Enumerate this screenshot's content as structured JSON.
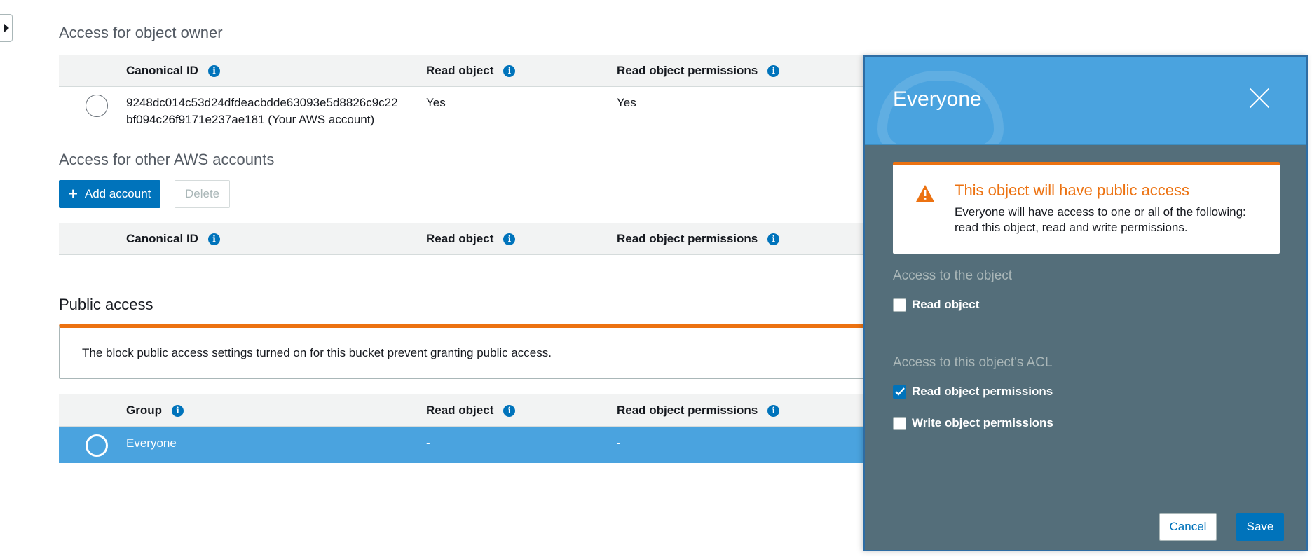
{
  "owner_section": {
    "title": "Access for object owner",
    "headers": {
      "canonical_id": "Canonical ID",
      "read_object": "Read object",
      "read_permissions": "Read object permissions"
    },
    "row": {
      "canonical_id_line1": "9248dc014c53d24dfdeacbdde63093e5d8826c9c22",
      "canonical_id_line2": "bf094c26f9171e237ae181 (Your AWS account)",
      "read_object": "Yes",
      "read_permissions": "Yes"
    }
  },
  "other_accounts_section": {
    "title": "Access for other AWS accounts",
    "add_button": "Add account",
    "delete_button": "Delete",
    "headers": {
      "canonical_id": "Canonical ID",
      "read_object": "Read object",
      "read_permissions": "Read object permissions"
    }
  },
  "public_section": {
    "title": "Public access",
    "alert_text": "The block public access settings turned on for this bucket prevent granting public access.",
    "headers": {
      "group": "Group",
      "read_object": "Read object",
      "read_permissions": "Read object permissions"
    },
    "row": {
      "group": "Everyone",
      "read_object": "-",
      "read_permissions": "-"
    }
  },
  "panel": {
    "title": "Everyone",
    "warning_title": "This object will have public access",
    "warning_text": "Everyone will have access to one or all of the following: read this object, read and write permissions.",
    "object_group_label": "Access to the object",
    "acl_group_label": "Access to this object's ACL",
    "options": {
      "read_object": {
        "label": "Read object",
        "checked": false
      },
      "read_permissions": {
        "label": "Read object permissions",
        "checked": true
      },
      "write_permissions": {
        "label": "Write object permissions",
        "checked": false
      }
    },
    "cancel_button": "Cancel",
    "save_button": "Save"
  },
  "colors": {
    "accent": "#0073bb",
    "selected_row": "#4aa3df",
    "warning": "#ec7211",
    "panel_bg": "#546e7a"
  }
}
